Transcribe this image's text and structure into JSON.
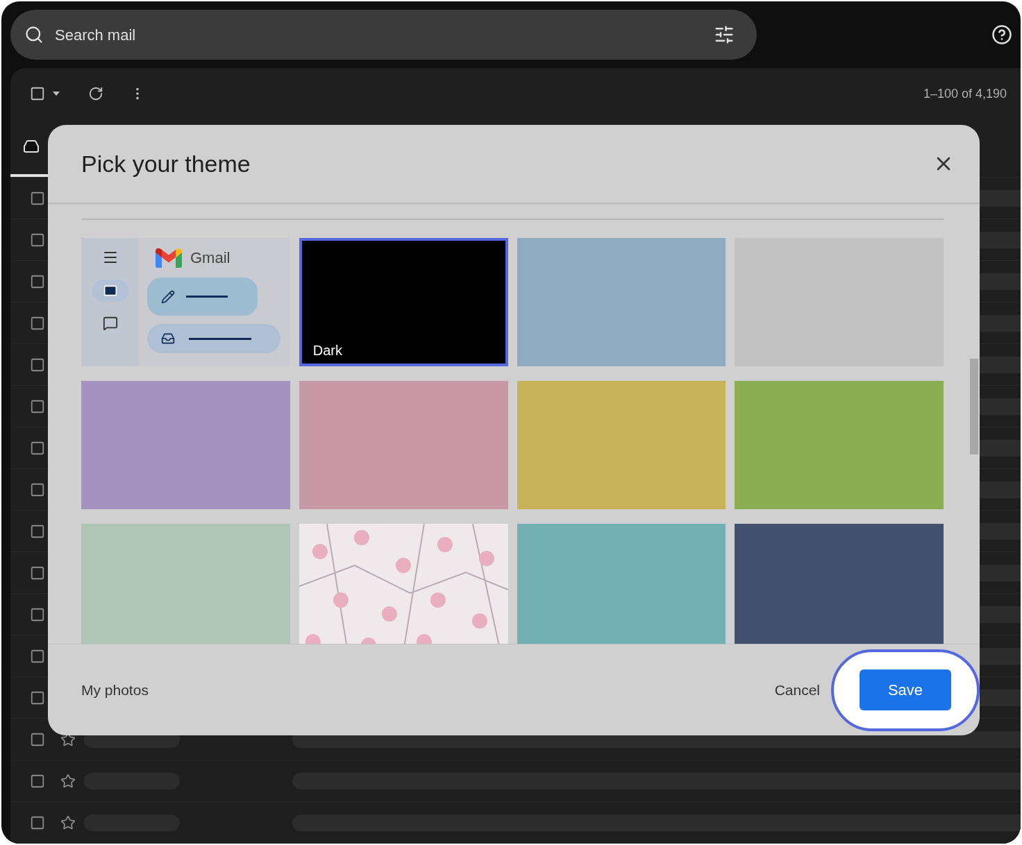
{
  "search": {
    "placeholder": "Search mail"
  },
  "toolbar": {
    "select_all_checked": false,
    "page_range": "1–100 of 4,190"
  },
  "tabs": [
    {
      "kind": "inbox",
      "selected": true
    }
  ],
  "message_rows": [
    {
      "kind": "covered",
      "checked": false
    },
    {
      "kind": "covered",
      "checked": false
    },
    {
      "kind": "covered",
      "checked": false
    },
    {
      "kind": "covered",
      "checked": false
    },
    {
      "kind": "covered",
      "checked": false
    },
    {
      "kind": "covered",
      "checked": false
    },
    {
      "kind": "covered",
      "checked": false
    },
    {
      "kind": "covered",
      "checked": false
    },
    {
      "kind": "covered",
      "checked": false
    },
    {
      "kind": "covered",
      "checked": false
    },
    {
      "kind": "covered",
      "checked": false
    },
    {
      "kind": "covered",
      "checked": false
    },
    {
      "kind": "covered",
      "checked": false
    },
    {
      "kind": "loading",
      "checked": false
    },
    {
      "kind": "loading",
      "checked": false
    },
    {
      "kind": "loading",
      "checked": false
    }
  ],
  "dialog": {
    "title": "Pick your theme",
    "themes": [
      {
        "kind": "preview",
        "brand": "Gmail",
        "selected": false
      },
      {
        "kind": "color",
        "label": "Dark",
        "color": "#000000",
        "selected": true
      },
      {
        "kind": "color",
        "color": "#8fabc0",
        "selected": false
      },
      {
        "kind": "color",
        "color": "#c2c2c2",
        "selected": false
      },
      {
        "kind": "color",
        "color": "#a492c0",
        "selected": false
      },
      {
        "kind": "color",
        "color": "#c799a6",
        "selected": false
      },
      {
        "kind": "color",
        "color": "#c7b25a",
        "selected": false
      },
      {
        "kind": "color",
        "color": "#8cae53",
        "selected": false
      },
      {
        "kind": "color",
        "color": "#b0c4b8",
        "selected": false
      },
      {
        "kind": "picture",
        "selected": false
      },
      {
        "kind": "color",
        "color": "#72b0b3",
        "selected": false
      },
      {
        "kind": "color",
        "color": "#42526e",
        "selected": false
      }
    ],
    "footer": {
      "link": "My photos",
      "cancel": "Cancel",
      "save": "Save",
      "save_highlighted": true
    }
  }
}
